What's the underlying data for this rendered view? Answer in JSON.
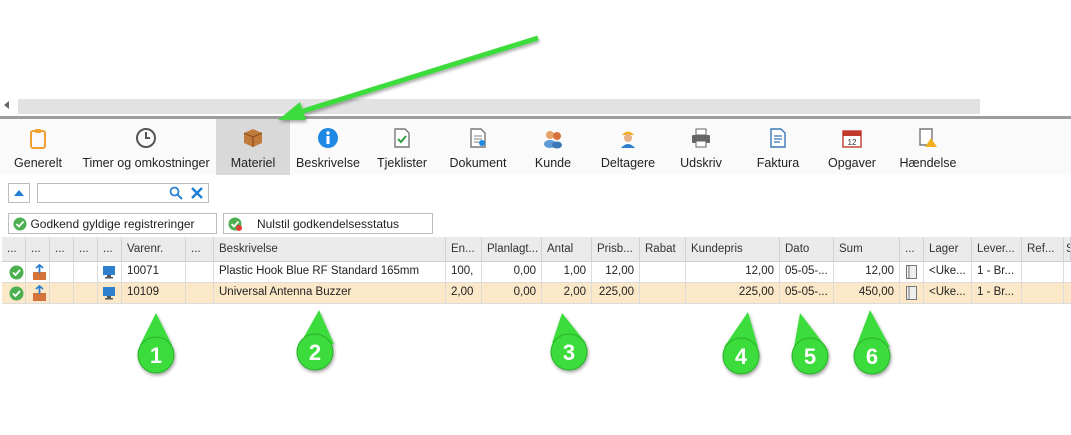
{
  "toolbar": {
    "items": [
      {
        "label": "Generelt",
        "icon": "clipboard-icon"
      },
      {
        "label": "Timer og omkostninger",
        "icon": "clock-icon"
      },
      {
        "label": "Materiel",
        "icon": "box-icon",
        "active": true
      },
      {
        "label": "Beskrivelse",
        "icon": "info-icon"
      },
      {
        "label": "Tjeklister",
        "icon": "checklist-icon"
      },
      {
        "label": "Dokument",
        "icon": "document-icon"
      },
      {
        "label": "Kunde",
        "icon": "customers-icon"
      },
      {
        "label": "Deltagere",
        "icon": "worker-icon"
      },
      {
        "label": "Udskriv",
        "icon": "printer-icon"
      },
      {
        "label": "Faktura",
        "icon": "invoice-icon"
      },
      {
        "label": "Opgaver",
        "icon": "calendar-icon"
      },
      {
        "label": "Hændelse",
        "icon": "event-warning-icon"
      }
    ]
  },
  "search": {
    "value": ""
  },
  "approve_button": "Godkend gyldige registreringer",
  "reset_button": "Nulstil godkendelsesstatus",
  "grid": {
    "headers": [
      "...",
      "...",
      "...",
      "...",
      "...",
      "Varenr.",
      "...",
      "Beskrivelse",
      "En...",
      "Planlagt...",
      "Antal",
      "Prisb...",
      "Rabat",
      "Kundepris",
      "Dato",
      "Sum",
      "...",
      "Lager",
      "Lever...",
      "Ref...",
      "S"
    ],
    "rows": [
      {
        "varenr": "10071",
        "beskrivelse": "Plastic Hook Blue RF Standard 165mm",
        "enhed": "100,",
        "planlagt": "0,00",
        "antal": "1,00",
        "prisb": "12,00",
        "rabat": "",
        "kundepris": "12,00",
        "dato": "05-05-...",
        "sum": "12,00",
        "lager": "<Uke...",
        "lever": "1 - Br...",
        "ref": ""
      },
      {
        "varenr": "10109",
        "beskrivelse": "Universal Antenna Buzzer",
        "enhed": "2,00",
        "planlagt": "0,00",
        "antal": "2,00",
        "prisb": "225,00",
        "rabat": "",
        "kundepris": "225,00",
        "dato": "05-05-...",
        "sum": "450,00",
        "lager": "<Uke...",
        "lever": "1 - Br...",
        "ref": "",
        "selected": true
      }
    ]
  },
  "callouts": [
    "1",
    "2",
    "3",
    "4",
    "5",
    "6"
  ],
  "colors": {
    "accent_green": "#3ddc3d",
    "selected_row": "#fbe8c8",
    "active_tab": "#d9d9d9"
  }
}
